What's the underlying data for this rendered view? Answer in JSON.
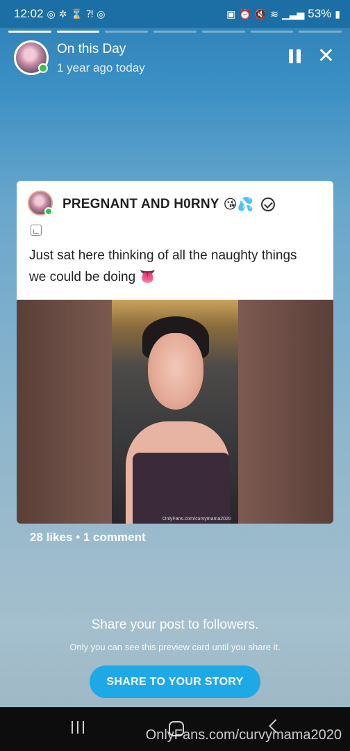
{
  "status_bar": {
    "time": "12:02",
    "left_icons": [
      "target-icon",
      "gear-icon",
      "hourglass-icon",
      "signal-icon",
      "target-icon"
    ],
    "right_icons": [
      "lock-icon",
      "alarm-icon",
      "mute-icon",
      "wifi-icon",
      "cell-signal-icon"
    ],
    "battery": "53%"
  },
  "story": {
    "progress_segments": 7,
    "progress_done": 2,
    "title": "On this Day",
    "subtitle": "1 year ago today"
  },
  "post": {
    "author": "PREGNANT AND H0RNY",
    "author_emoji": "😘💦",
    "text": "Just sat here thinking of all the naughty things we could be doing 👅",
    "image_watermark": "OnlyFans.com/curvymama2020",
    "likes": "28 likes",
    "separator": "•",
    "comments": "1 comment"
  },
  "share": {
    "title": "Share your post to followers.",
    "subtitle": "Only you can see this preview card until you share it.",
    "button_label": "SHARE TO YOUR STORY"
  },
  "watermark": "OnlyFans.com/curvymama2020",
  "colors": {
    "accent": "#1fa8e6",
    "status_bar": "#1c6fa5",
    "online": "#3cbf4a"
  }
}
